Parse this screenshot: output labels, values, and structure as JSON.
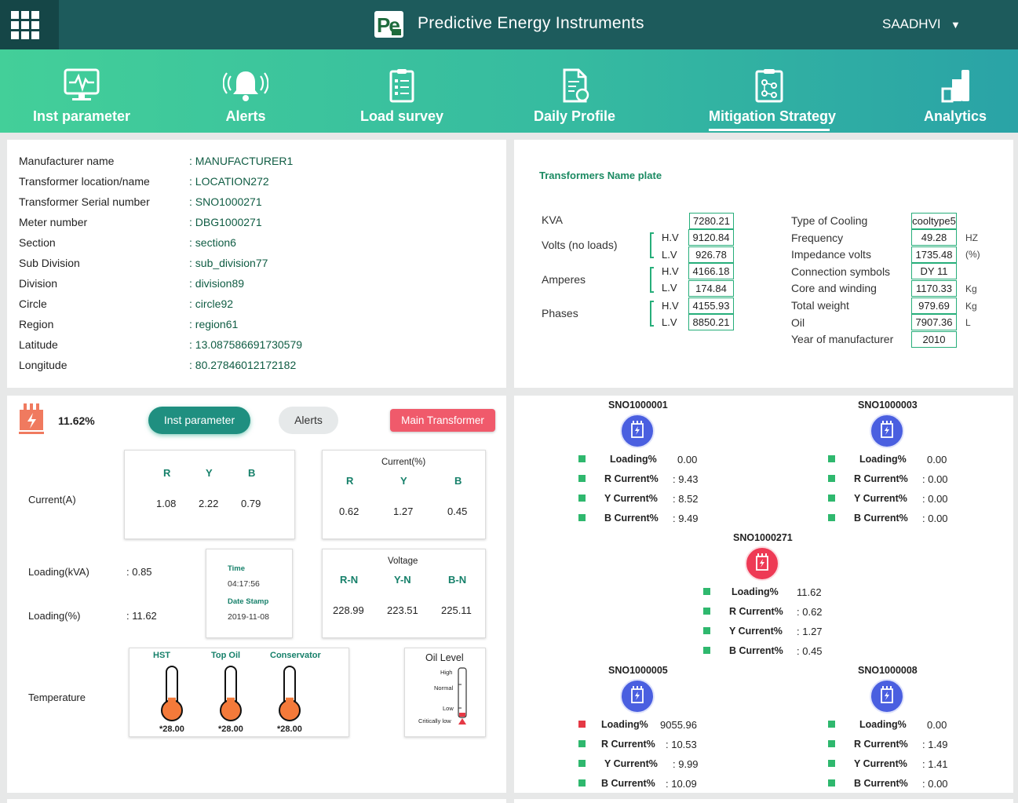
{
  "app": {
    "title": "Predictive Energy Instruments",
    "logo_text": "Pe",
    "user": "SAADHVI",
    "user_caret": "▼"
  },
  "nav": [
    {
      "label": "Inst parameter",
      "icon": "monitor-pulse-icon"
    },
    {
      "label": "Alerts",
      "icon": "bell-icon"
    },
    {
      "label": "Load survey",
      "icon": "clipboard-list-icon"
    },
    {
      "label": "Daily Profile",
      "icon": "document-refresh-icon"
    },
    {
      "label": "Mitigation Strategy",
      "icon": "clipboard-flow-icon",
      "active": true
    },
    {
      "label": "Analytics",
      "icon": "bar-steps-icon"
    }
  ],
  "info": [
    {
      "label": "Manufacturer name",
      "value": ": MANUFACTURER1"
    },
    {
      "label": "Transformer location/name",
      "value": ": LOCATION272"
    },
    {
      "label": "Transformer Serial number",
      "value": ": SNO1000271"
    },
    {
      "label": "Meter number",
      "value": ": DBG1000271"
    },
    {
      "label": "Section",
      "value": ": section6"
    },
    {
      "label": "Sub Division",
      "value": ": sub_division77"
    },
    {
      "label": "Division",
      "value": ": division89"
    },
    {
      "label": "Circle",
      "value": ": circle92"
    },
    {
      "label": "Region",
      "value": ": region61"
    },
    {
      "label": "Latitude",
      "value": ": 13.087586691730579"
    },
    {
      "label": "Longitude",
      "value": ": 80.27846012172182"
    }
  ],
  "nameplate": {
    "title": "Transformers Name plate",
    "kva_label": "KVA",
    "kva": "7280.21",
    "volts_label": "Volts (no loads)",
    "amperes_label": "Amperes",
    "phases_label": "Phases",
    "hv": "H.V",
    "lv": "L.V",
    "volts_hv": "9120.84",
    "volts_lv": "926.78",
    "amp_hv": "4166.18",
    "amp_lv": "174.84",
    "ph_hv": "4155.93",
    "ph_lv": "8850.21",
    "right": [
      {
        "label": "Type of Cooling",
        "value": "cooltype5",
        "unit": ""
      },
      {
        "label": "Frequency",
        "value": "49.28",
        "unit": "HZ"
      },
      {
        "label": "Impedance volts",
        "value": "1735.48",
        "unit": "(%)"
      },
      {
        "label": "Connection symbols",
        "value": "DY 11",
        "unit": ""
      },
      {
        "label": "Core and winding",
        "value": "1170.33",
        "unit": "Kg"
      },
      {
        "label": "Total weight",
        "value": "979.69",
        "unit": "Kg"
      },
      {
        "label": "Oil",
        "value": "7907.36",
        "unit": "L"
      },
      {
        "label": "Year of manufacturer",
        "value": "2010",
        "unit": ""
      }
    ]
  },
  "inst": {
    "percent": "11.62%",
    "btn_inst": "Inst parameter",
    "btn_alerts": "Alerts",
    "btn_main": "Main Transformer",
    "current_label": "Current(A)",
    "phases": [
      "R",
      "Y",
      "B"
    ],
    "current_a": [
      "1.08",
      "2.22",
      "0.79"
    ],
    "current_pct_title": "Current(%)",
    "current_pct": [
      "0.62",
      "1.27",
      "0.45"
    ],
    "loading_kva_label": "Loading(kVA)",
    "loading_kva": ": 0.85",
    "loading_pct_label": "Loading(%)",
    "loading_pct": ": 11.62",
    "time_label": "Time",
    "time": "04:17:56",
    "date_label": "Date Stamp",
    "date": "2019-11-08",
    "voltage_title": "Voltage",
    "voltage_phases": [
      "R-N",
      "Y-N",
      "B-N"
    ],
    "voltage": [
      "228.99",
      "223.51",
      "225.11"
    ],
    "temp_label": "Temperature",
    "temps": [
      {
        "name": "HST",
        "value": "*28.00",
        "fill": 0.28
      },
      {
        "name": "Top Oil",
        "value": "*28.00",
        "fill": 0.28
      },
      {
        "name": "Conservator",
        "value": "*28.00",
        "fill": 0.28
      }
    ],
    "oil": {
      "title": "Oil Level",
      "high": "High",
      "normal": "Normal",
      "low": "Low",
      "critical": "Critically low",
      "level": "Critically low"
    }
  },
  "network": [
    {
      "sno": "SNO1000001",
      "loading": "0.00",
      "r": ": 9.43",
      "y": ": 8.52",
      "b": ": 9.49",
      "alert": false
    },
    {
      "sno": "SNO1000003",
      "loading": "0.00",
      "r": ": 0.00",
      "y": ": 0.00",
      "b": ": 0.00",
      "alert": false
    },
    {
      "sno": "SNO1000271",
      "loading": "11.62",
      "r": ": 0.62",
      "y": ": 1.27",
      "b": ": 0.45",
      "alert": false,
      "main": true
    },
    {
      "sno": "SNO1000005",
      "loading": "9055.96",
      "r": ": 10.53",
      "y": ": 9.99",
      "b": ": 10.09",
      "alert": true
    },
    {
      "sno": "SNO1000008",
      "loading": "0.00",
      "r": ": 1.49",
      "y": ": 1.41",
      "b": ": 0.00",
      "alert": false
    }
  ],
  "net_labels": {
    "loading": "Loading%",
    "r": "R Current%",
    "y": "Y Current%",
    "b": "B Current%"
  },
  "colors": {
    "header": "#1d5b5c",
    "accent": "#27ae7a",
    "node": "#4a5fe0",
    "main_node": "#ee3a55",
    "alert": "#e53945",
    "ok": "#2fb86e"
  }
}
